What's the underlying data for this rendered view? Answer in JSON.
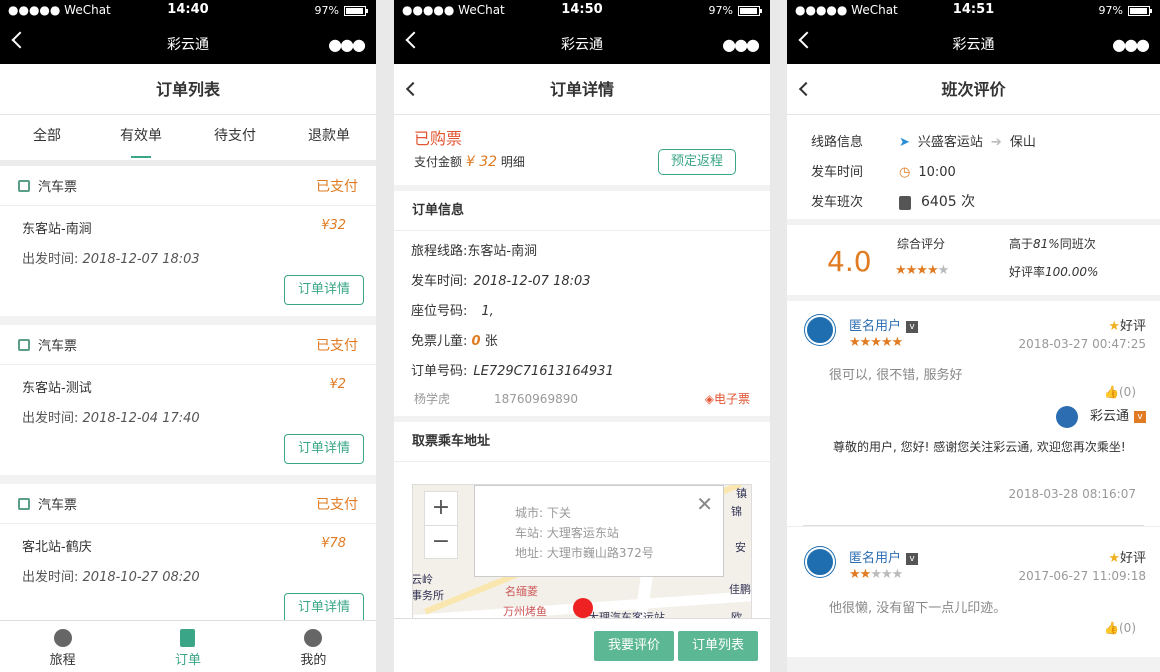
{
  "status": [
    {
      "carrier": "●●●●● WeChat",
      "time": "14:40",
      "battery": "97%"
    },
    {
      "carrier": "●●●●● WeChat",
      "time": "14:50",
      "battery": "97%"
    },
    {
      "carrier": "●●●●● WeChat",
      "time": "14:51",
      "battery": "97%"
    }
  ],
  "app_title": "彩云通",
  "p1": {
    "header": "订单列表",
    "tabs": [
      "全部",
      "有效单",
      "待支付",
      "退款单"
    ],
    "orders": [
      {
        "type": "汽车票",
        "status": "已支付",
        "route": "东客站-南涧",
        "price": "¥32",
        "dep_label": "出发时间:",
        "dep_time": "2018-12-07 18:03",
        "btn": "订单详情"
      },
      {
        "type": "汽车票",
        "status": "已支付",
        "route": "东客站-测试",
        "price": "¥2",
        "dep_label": "出发时间:",
        "dep_time": "2018-12-04 17:40",
        "btn": "订单详情"
      },
      {
        "type": "汽车票",
        "status": "已支付",
        "route": "客北站-鹤庆",
        "price": "¥78",
        "dep_label": "出发时间:",
        "dep_time": "2018-10-27 08:20",
        "btn": "订单详情"
      }
    ],
    "tabbar": [
      "旅程",
      "订单",
      "我的"
    ]
  },
  "p2": {
    "header": "订单详情",
    "status": "已购票",
    "pay_label": "支付金额",
    "pay_amount": "¥ 32",
    "detail_link": "明细",
    "return_btn": "预定返程",
    "info_title": "订单信息",
    "rows": [
      {
        "label": "旅程线路:",
        "value": "东客站-南涧"
      },
      {
        "label": "发车时间:",
        "value": "2018-12-07 18:03"
      },
      {
        "label": "座位号码:",
        "value": "1,"
      },
      {
        "label": "免票儿童:",
        "value": "0",
        "suffix": "张"
      },
      {
        "label": "订单号码:",
        "value": "LE729C71613164931"
      }
    ],
    "contact_name": "杨学虎",
    "contact_phone": "18760969890",
    "eticket": "电子票",
    "addr_title": "取票乘车地址",
    "map_popup": {
      "city": "城市: 下关",
      "station": "车站: 大理客运东站",
      "address": "地址: 大理市巍山路372号"
    },
    "map_labels": [
      "万州烤鱼",
      "大理汽车客运站",
      "名缅菱",
      "云岭",
      "事务所",
      "锦",
      "安",
      "佳鹏",
      "欧",
      "镇"
    ],
    "btn_review": "我要评价",
    "btn_list": "订单列表"
  },
  "p3": {
    "header": "班次评价",
    "route_label": "线路信息",
    "route_from": "兴盛客运站",
    "route_to": "保山",
    "time_label": "发车时间",
    "time_value": "10:00",
    "shift_label": "发车班次",
    "shift_value": "6405 次",
    "score": "4.0",
    "overall_label": "综合评分",
    "higher_prefix": "高于",
    "higher_pct": "81%",
    "higher_suffix": "同班次",
    "good_label": "好评率",
    "good_rate": "100.00%",
    "reviews": [
      {
        "user": "匿名用户",
        "tag": "好评",
        "time": "2018-03-27 00:47:25",
        "text": "很可以, 很不错, 服务好",
        "likes": "(0)",
        "stars": 5,
        "reply_name": "彩云通",
        "reply_text": "尊敬的用户, 您好! 感谢您关注彩云通, 欢迎您再次乘坐!",
        "reply_time": "2018-03-28 08:16:07"
      },
      {
        "user": "匿名用户",
        "tag": "好评",
        "time": "2017-06-27 11:09:18",
        "text": "他很懒, 没有留下一点儿印迹。",
        "likes": "(0)",
        "stars": 2
      }
    ]
  },
  "colors": {
    "accent": "#3aa687",
    "orange": "#e07b22",
    "red": "#e25533",
    "btn_green": "#5cb794"
  }
}
